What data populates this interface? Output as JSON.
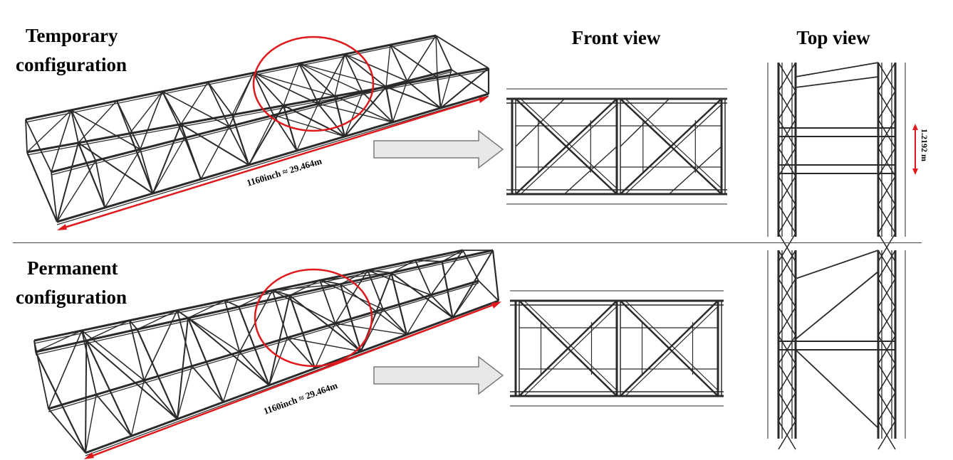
{
  "headers": {
    "front_view": "Front view",
    "top_view": "Top view"
  },
  "rows": [
    {
      "id": "temporary",
      "label_line1": "Temporary",
      "label_line2": "configuration",
      "length_label": "1160inch ≈ 29.464m",
      "top_dim_label": "1.2192 m"
    },
    {
      "id": "permanent",
      "label_line1": "Permanent",
      "label_line2": "configuration",
      "length_label": "1160inch ≈ 29.464m"
    }
  ],
  "colors": {
    "dimension_line": "#e0191c",
    "highlight_circle": "#e0191c",
    "arrow_fill": "#e8e8e8",
    "arrow_stroke": "#7a7a7a",
    "member": "#2a2a2a"
  }
}
